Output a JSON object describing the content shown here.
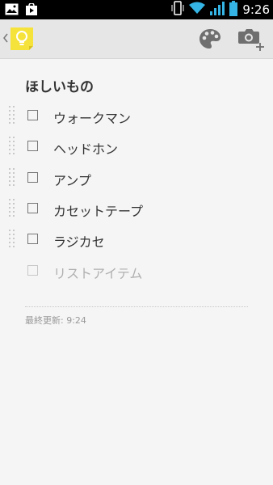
{
  "status_bar": {
    "time": "9:26",
    "left_icons": [
      "gallery-notification-icon",
      "play-store-notification-icon"
    ],
    "right_icons": [
      "phone-vibrate-icon",
      "wifi-icon",
      "signal-icon",
      "battery-icon"
    ]
  },
  "action_bar": {
    "up_icon": "chevron-left-icon",
    "app_icon": "keep-lightbulb-icon",
    "actions": [
      "palette-icon",
      "add-photo-icon"
    ],
    "app_icon_color": "#f5e23b"
  },
  "note": {
    "title": "ほしいもの",
    "items": [
      {
        "text": "ウォークマン",
        "checked": false
      },
      {
        "text": "ヘッドホン",
        "checked": false
      },
      {
        "text": "アンプ",
        "checked": false
      },
      {
        "text": "カセットテープ",
        "checked": false
      },
      {
        "text": "ラジカセ",
        "checked": false
      }
    ],
    "new_item_placeholder": "リストアイテム",
    "last_updated": "最終更新: 9:24"
  }
}
